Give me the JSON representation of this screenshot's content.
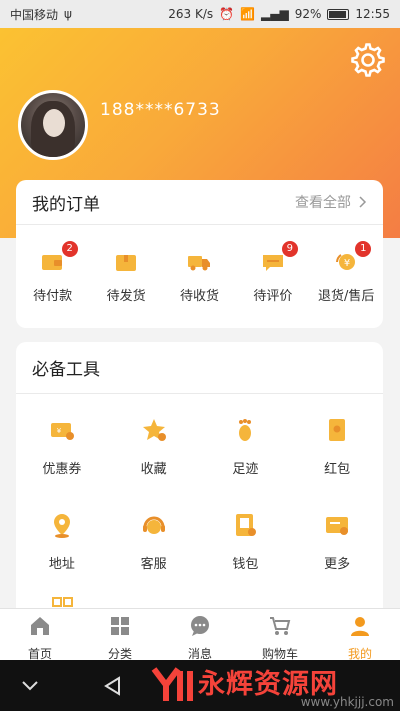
{
  "status_bar": {
    "carrier": "中国移动",
    "usb": "ψ",
    "speed": "263 K/s",
    "battery": "92%",
    "time": "12:55"
  },
  "profile": {
    "phone": "188****6733"
  },
  "orders": {
    "title": "我的订单",
    "view_all": "查看全部",
    "items": [
      {
        "label": "待付款",
        "badge": "2"
      },
      {
        "label": "待发货",
        "badge": ""
      },
      {
        "label": "待收货",
        "badge": ""
      },
      {
        "label": "待评价",
        "badge": "9"
      },
      {
        "label": "退货/售后",
        "badge": "1"
      }
    ]
  },
  "tools": {
    "title": "必备工具",
    "items": [
      {
        "label": "优惠券"
      },
      {
        "label": "收藏"
      },
      {
        "label": "足迹"
      },
      {
        "label": "红包"
      },
      {
        "label": "地址"
      },
      {
        "label": "客服"
      },
      {
        "label": "钱包"
      },
      {
        "label": "更多"
      }
    ]
  },
  "tabbar": {
    "items": [
      {
        "label": "首页"
      },
      {
        "label": "分类"
      },
      {
        "label": "消息"
      },
      {
        "label": "购物车"
      },
      {
        "label": "我的"
      }
    ]
  },
  "watermark": {
    "text": "永辉资源网",
    "url": "www.yhkjjj.com"
  },
  "colors": {
    "accent": "#f39a1e",
    "hero_start": "#fbc232",
    "hero_end": "#f47d44",
    "badge": "#e2342b"
  }
}
